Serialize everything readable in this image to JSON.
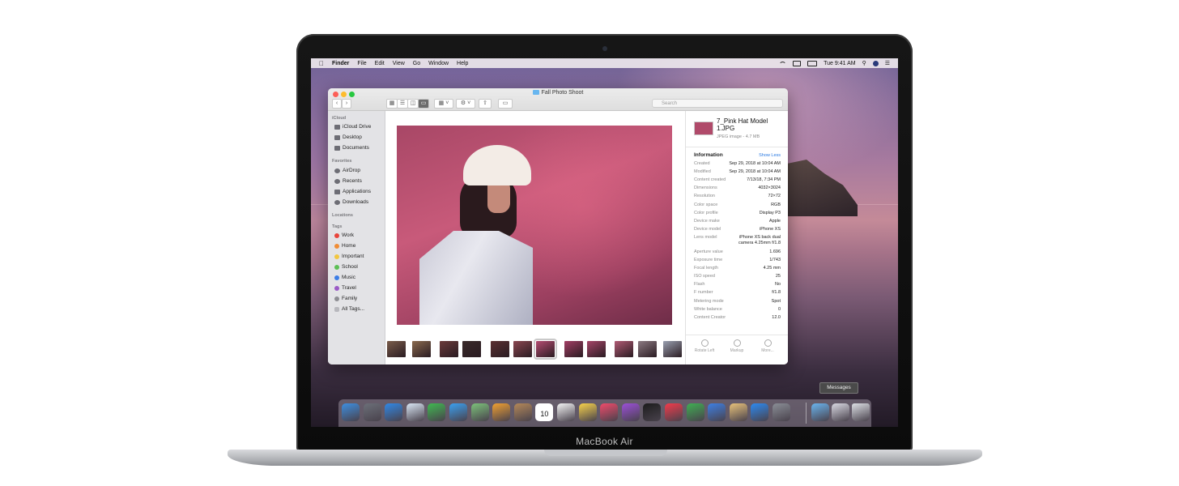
{
  "menubar": {
    "app_name": "Finder",
    "items": [
      "File",
      "Edit",
      "View",
      "Go",
      "Window",
      "Help"
    ],
    "clock": "Tue 9:41 AM"
  },
  "window": {
    "title": "Fall Photo Shoot",
    "search_placeholder": "Search"
  },
  "sidebar": {
    "icloud_header": "iCloud",
    "icloud_items": [
      "iCloud Drive",
      "Desktop",
      "Documents"
    ],
    "favorites_header": "Favorites",
    "favorites_items": [
      "AirDrop",
      "Recents",
      "Applications",
      "Downloads"
    ],
    "locations_header": "Locations",
    "tags_header": "Tags",
    "tags": [
      {
        "label": "Work",
        "color": "#e8453c"
      },
      {
        "label": "Home",
        "color": "#f08d36"
      },
      {
        "label": "Important",
        "color": "#f2c640"
      },
      {
        "label": "School",
        "color": "#5cbf55"
      },
      {
        "label": "Music",
        "color": "#3d7ee6"
      },
      {
        "label": "Travel",
        "color": "#9a5ac6"
      },
      {
        "label": "Family",
        "color": "#8e8e93"
      },
      {
        "label": "All Tags...",
        "color": ""
      }
    ]
  },
  "inspector": {
    "file_name": "7_Pink Hat Model 1.JPG",
    "file_type": "JPEG image - 4.7 MB",
    "info_header": "Information",
    "show_less": "Show Less",
    "rows": [
      {
        "k": "Created",
        "v": "Sep 29, 2018 at 10:04 AM"
      },
      {
        "k": "Modified",
        "v": "Sep 29, 2018 at 10:04 AM"
      },
      {
        "k": "Content created",
        "v": "7/13/18, 7:34 PM"
      },
      {
        "k": "Dimensions",
        "v": "4032×3024"
      },
      {
        "k": "Resolution",
        "v": "72×72"
      },
      {
        "k": "Color space",
        "v": "RGB"
      },
      {
        "k": "Color profile",
        "v": "Display P3"
      },
      {
        "k": "Device make",
        "v": "Apple"
      },
      {
        "k": "Device model",
        "v": "iPhone XS"
      },
      {
        "k": "Lens model",
        "v": "iPhone XS back dual camera 4.25mm f/1.8"
      },
      {
        "k": "Aperture value",
        "v": "1.696"
      },
      {
        "k": "Exposure time",
        "v": "1/743"
      },
      {
        "k": "Focal length",
        "v": "4.25 mm"
      },
      {
        "k": "ISO speed",
        "v": "25"
      },
      {
        "k": "Flash",
        "v": "No"
      },
      {
        "k": "F number",
        "v": "f/1.8"
      },
      {
        "k": "Metering mode",
        "v": "Spot"
      },
      {
        "k": "White balance",
        "v": "0"
      },
      {
        "k": "Content Creator",
        "v": "12.0"
      }
    ],
    "actions": [
      "Rotate Left",
      "Markup",
      "More..."
    ]
  },
  "dock": {
    "tooltip": "Messages",
    "calendar_day": "10"
  },
  "laptop": {
    "brand": "MacBook Air"
  },
  "thumbnails": [
    {
      "color": "#7a5c4a",
      "selected": false
    },
    {
      "color": "#8a6a4e",
      "selected": false
    },
    {
      "color": "#6b3a3a",
      "selected": false
    },
    {
      "color": "#3a2a2a",
      "selected": false
    },
    {
      "color": "#5a3032",
      "selected": false
    },
    {
      "color": "#8a4650",
      "selected": false
    },
    {
      "color": "#b44c72",
      "selected": true
    },
    {
      "color": "#a23e64",
      "selected": false
    },
    {
      "color": "#a54468",
      "selected": false
    },
    {
      "color": "#b05a74",
      "selected": false
    },
    {
      "color": "#8c7a82",
      "selected": false
    },
    {
      "color": "#9aa0b0",
      "selected": false
    }
  ],
  "dock_apps": [
    {
      "name": "finder-app",
      "color": "#3d8fe0"
    },
    {
      "name": "launchpad-app",
      "color": "#6b6f78"
    },
    {
      "name": "safari-app",
      "color": "#2f88e6"
    },
    {
      "name": "mail-app",
      "color": "#d9e6f4"
    },
    {
      "name": "facetime-app",
      "color": "#3fb950"
    },
    {
      "name": "messages-app",
      "color": "#3aa0f0"
    },
    {
      "name": "maps-app",
      "color": "#7cc27a"
    },
    {
      "name": "photos-app",
      "color": "#f0a030"
    },
    {
      "name": "contacts-app",
      "color": "#b48858"
    },
    {
      "name": "calendar-app",
      "color": "#ffffff"
    },
    {
      "name": "reminders-app",
      "color": "#f4f4f4"
    },
    {
      "name": "notes-app",
      "color": "#f7d24a"
    },
    {
      "name": "music-app",
      "color": "#f04a6a"
    },
    {
      "name": "podcasts-app",
      "color": "#9b4fd8"
    },
    {
      "name": "tv-app",
      "color": "#1b1b1b"
    },
    {
      "name": "news-app",
      "color": "#f23a4a"
    },
    {
      "name": "numbers-app",
      "color": "#3fae52"
    },
    {
      "name": "keynote-app",
      "color": "#3d7fe3"
    },
    {
      "name": "preview-app",
      "color": "#e8c27a"
    },
    {
      "name": "app-store-app",
      "color": "#2c8af0"
    },
    {
      "name": "system-preferences-app",
      "color": "#8a8e96"
    },
    {
      "name": "downloads-folder",
      "color": "#6ab4ee"
    },
    {
      "name": "documents-stack",
      "color": "#d9d9e2"
    },
    {
      "name": "trash",
      "color": "#dcdfe4"
    }
  ]
}
